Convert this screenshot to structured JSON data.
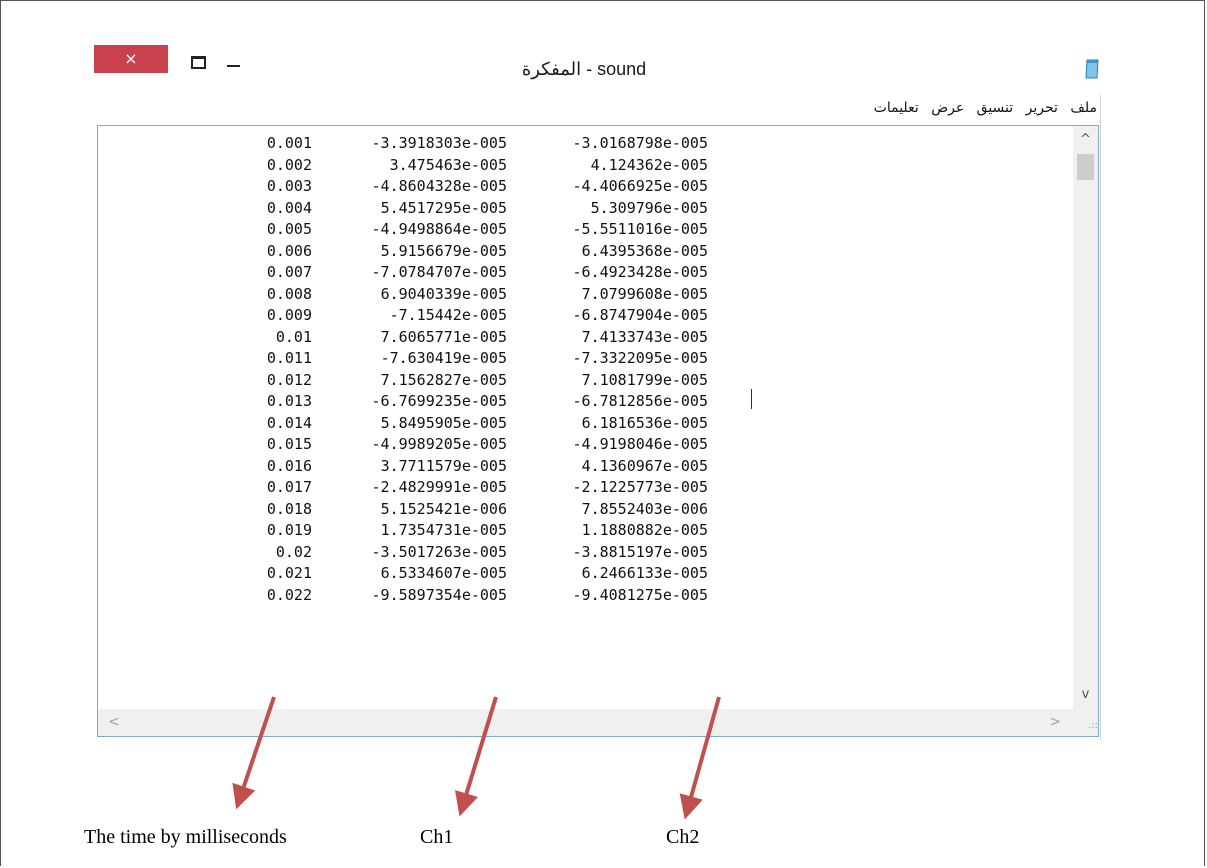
{
  "window": {
    "title": "المفكرة - sound",
    "close_glyph": "×"
  },
  "menu": [
    "ملف",
    "تحرير",
    "تنسيق",
    "عرض",
    "تعليمات"
  ],
  "rows": [
    [
      "0.001",
      "-3.3918303e-005",
      "-3.0168798e-005"
    ],
    [
      "0.002",
      "3.475463e-005",
      "4.124362e-005"
    ],
    [
      "0.003",
      "-4.8604328e-005",
      "-4.4066925e-005"
    ],
    [
      "0.004",
      "5.4517295e-005",
      "5.309796e-005"
    ],
    [
      "0.005",
      "-4.9498864e-005",
      "-5.5511016e-005"
    ],
    [
      "0.006",
      "5.9156679e-005",
      "6.4395368e-005"
    ],
    [
      "0.007",
      "-7.0784707e-005",
      "-6.4923428e-005"
    ],
    [
      "0.008",
      "6.9040339e-005",
      "7.0799608e-005"
    ],
    [
      "0.009",
      "-7.15442e-005",
      "-6.8747904e-005"
    ],
    [
      "0.01",
      "7.6065771e-005",
      "7.4133743e-005"
    ],
    [
      "0.011",
      "-7.630419e-005",
      "-7.3322095e-005"
    ],
    [
      "0.012",
      "7.1562827e-005",
      "7.1081799e-005"
    ],
    [
      "0.013",
      "-6.7699235e-005",
      "-6.7812856e-005"
    ],
    [
      "0.014",
      "5.8495905e-005",
      "6.1816536e-005"
    ],
    [
      "0.015",
      "-4.9989205e-005",
      "-4.9198046e-005"
    ],
    [
      "0.016",
      "3.7711579e-005",
      "4.1360967e-005"
    ],
    [
      "0.017",
      "-2.4829991e-005",
      "-2.1225773e-005"
    ],
    [
      "0.018",
      "5.1525421e-006",
      "7.8552403e-006"
    ],
    [
      "0.019",
      "1.7354731e-005",
      "1.1880882e-005"
    ],
    [
      "0.02",
      "-3.5017263e-005",
      "-3.8815197e-005"
    ],
    [
      "0.021",
      "6.5334607e-005",
      "6.2466133e-005"
    ],
    [
      "0.022",
      "-9.5897354e-005",
      "-9.4081275e-005"
    ]
  ],
  "annotations": {
    "time_label": "The time by milliseconds",
    "ch1_label": "Ch1",
    "ch2_label": "Ch2",
    "arrow_color": "#c0504d"
  },
  "colors": {
    "close_button": "#c9414c",
    "editor_border": "#7ea8d8"
  }
}
